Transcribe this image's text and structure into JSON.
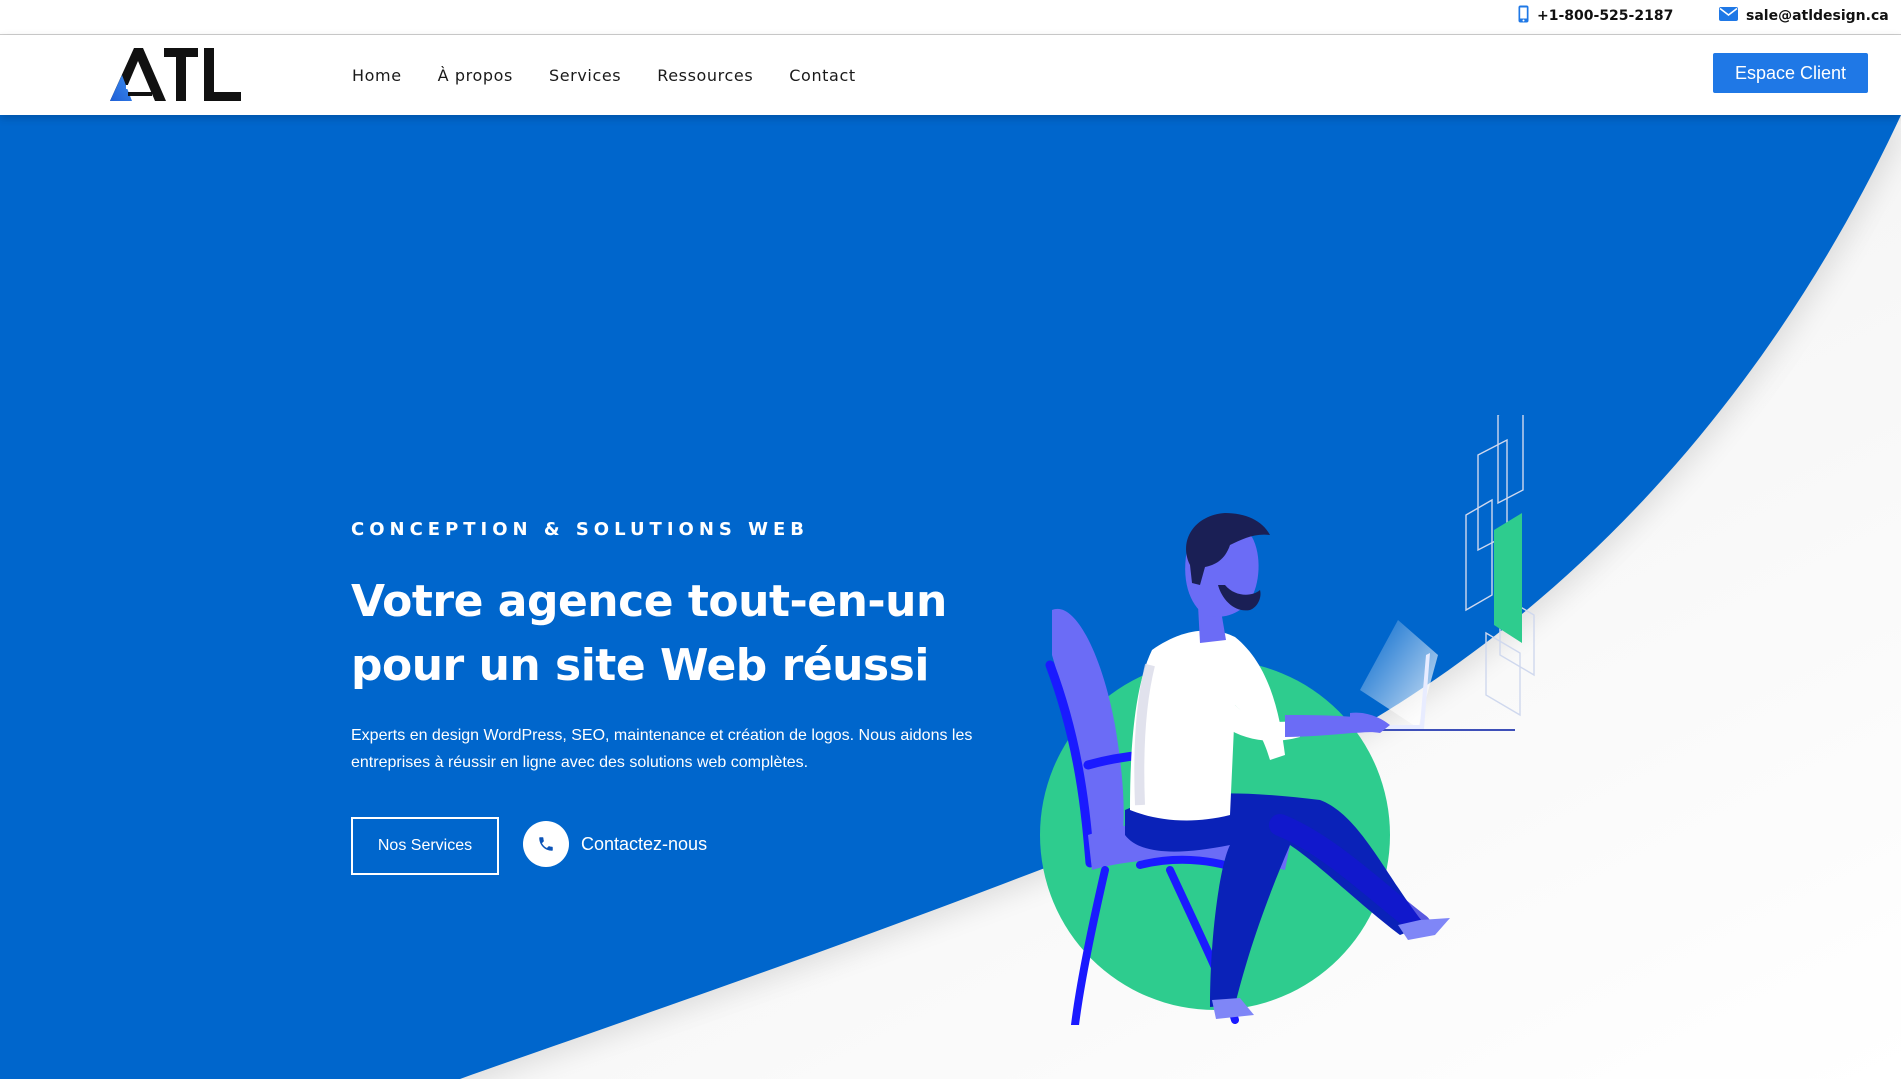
{
  "topbar": {
    "phone": "+1-800-525-2187",
    "phone_icon": "mobile-phone-icon",
    "email": "sale@atldesign.ca",
    "email_icon": "envelope-icon"
  },
  "header": {
    "logo_text": "ATL",
    "nav": [
      {
        "label": "Home"
      },
      {
        "label": "À propos"
      },
      {
        "label": "Services"
      },
      {
        "label": "Ressources"
      },
      {
        "label": "Contact"
      }
    ],
    "cta_label": "Espace Client"
  },
  "hero": {
    "eyebrow": "CONCEPTION & SOLUTIONS WEB",
    "headline_line1": "Votre agence tout-en-un",
    "headline_line2": "pour un site Web réussi",
    "description": "Experts en design WordPress, SEO, maintenance et création de logos. Nous aidons les entreprises à réussir en ligne avec des solutions web complètes.",
    "primary_button": "Nos Services",
    "secondary_link": "Contactez-nous",
    "secondary_icon": "phone-icon",
    "illustration": "person-with-laptop-illustration"
  },
  "colors": {
    "brand_blue": "#0066cc",
    "button_blue": "#1f78e6",
    "accent_green": "#2ecc8e",
    "illustration_purple": "#6b6cf6",
    "logo_dark": "#111111"
  }
}
